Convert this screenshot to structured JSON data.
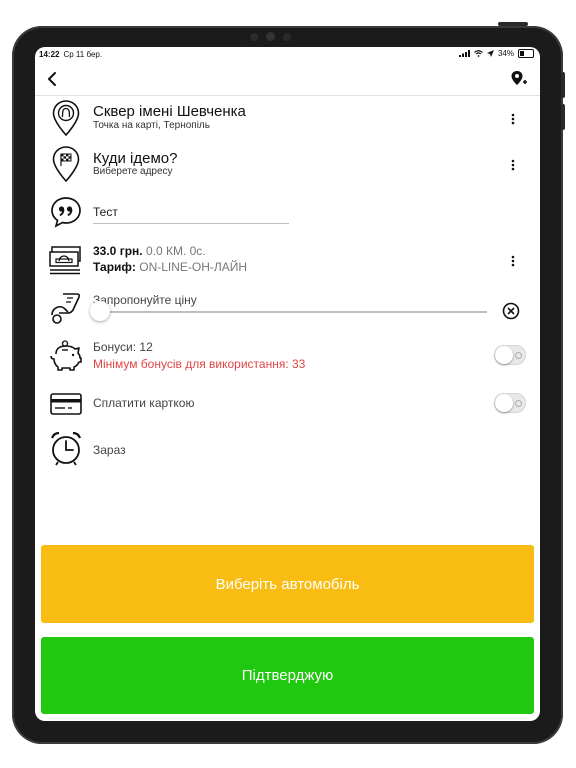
{
  "status_bar": {
    "time": "14:22",
    "date": "Ср 11 бер.",
    "battery": "34%"
  },
  "icons": {
    "back": "chevron-left-icon",
    "add_location": "add-location-pin-icon",
    "origin": "pin-person-icon",
    "destination": "pin-flag-icon",
    "comment": "quote-bubble-icon",
    "price": "money-icon",
    "offer": "hand-money-icon",
    "bonus": "piggy-bank-icon",
    "card": "credit-card-icon",
    "time": "alarm-clock-icon",
    "menu": "more-vertical-icon",
    "clear": "close-circle-icon"
  },
  "route": {
    "origin": {
      "title": "Сквер імені Шевченка",
      "subtitle": "Точка на карті, Тернопіль"
    },
    "destination": {
      "title": "Куди ідемо?",
      "subtitle": "Виберете адресу"
    }
  },
  "comment": {
    "value": "Тест"
  },
  "price": {
    "amount": "33.0 грн.",
    "distance_time": "0.0 КМ. 0с.",
    "tariff_label": "Тариф:",
    "tariff_value": "ON-LINE-ОН-ЛАЙН"
  },
  "offer": {
    "label": "Запропонуйте ціну",
    "slider_value": 0
  },
  "bonus": {
    "label": "Бонуси: 12",
    "warning": "Мінімум бонусів для використання: 33",
    "enabled": false
  },
  "card": {
    "label": "Сплатити карткою",
    "enabled": false
  },
  "time": {
    "label": "Зараз"
  },
  "buttons": {
    "choose_car": "Виберіть автомобіль",
    "confirm": "Підтверджую"
  },
  "colors": {
    "choose_car": "#f9bc12",
    "confirm": "#20c80f",
    "warning": "#e04545"
  }
}
